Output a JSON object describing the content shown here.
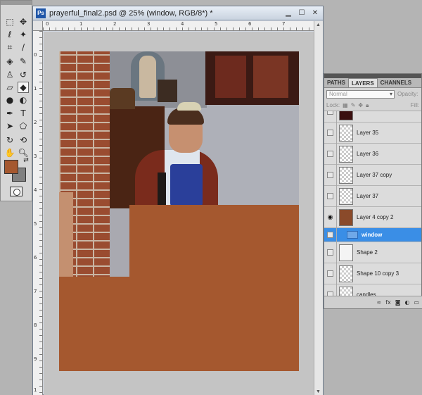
{
  "document": {
    "title": "prayerful_final2.psd @ 25% (window, RGB/8*) *",
    "icon_label": "Ps"
  },
  "ruler": {
    "top_numbers": [
      "0",
      "1",
      "2",
      "3",
      "4",
      "5",
      "6",
      "7"
    ],
    "left_numbers": [
      "0",
      "1",
      "2",
      "3",
      "4",
      "5",
      "6",
      "7",
      "8",
      "9",
      "1"
    ]
  },
  "tools": {
    "foreground_color": "#a5582f",
    "background_color": "#808080"
  },
  "layers_panel": {
    "tabs": [
      "PATHS",
      "LAYERS",
      "CHANNELS"
    ],
    "active_tab": "LAYERS",
    "blend_mode": "Normal",
    "opacity_label": "Opacity:",
    "lock_label": "Lock:",
    "fill_label": "Fill:",
    "layers": [
      {
        "name": "",
        "visible": false,
        "type": "partial"
      },
      {
        "name": "Layer 35",
        "visible": false,
        "type": "layer"
      },
      {
        "name": "Layer 36",
        "visible": false,
        "type": "layer"
      },
      {
        "name": "Layer 37 copy",
        "visible": false,
        "type": "layer"
      },
      {
        "name": "Layer 37",
        "visible": false,
        "type": "layer"
      },
      {
        "name": "Layer 4 copy 2",
        "visible": true,
        "type": "layer"
      },
      {
        "name": "window",
        "visible": false,
        "type": "group",
        "selected": true
      },
      {
        "name": "Shape 2",
        "visible": false,
        "type": "layer"
      },
      {
        "name": "Shape 10 copy 3",
        "visible": false,
        "type": "layer"
      },
      {
        "name": "candles",
        "visible": false,
        "type": "layer"
      }
    ]
  }
}
